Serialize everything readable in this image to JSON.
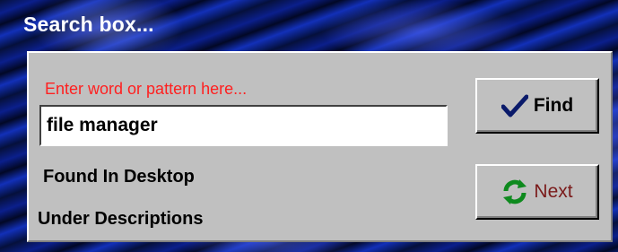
{
  "window": {
    "title": "Search box..."
  },
  "search": {
    "prompt": "Enter word or pattern here...",
    "value": "file manager"
  },
  "results": {
    "found_in": "Found In Desktop",
    "under": "Under Descriptions"
  },
  "buttons": {
    "find": {
      "label": "Find",
      "icon": "checkmark-icon"
    },
    "next": {
      "label": "Next",
      "icon": "refresh-arrows-icon"
    }
  },
  "colors": {
    "panel": "#c0c0c0",
    "prompt_text": "#ff2020",
    "next_label": "#7a1a1a",
    "title_text": "#ffffff",
    "background": "#0a1a70"
  }
}
